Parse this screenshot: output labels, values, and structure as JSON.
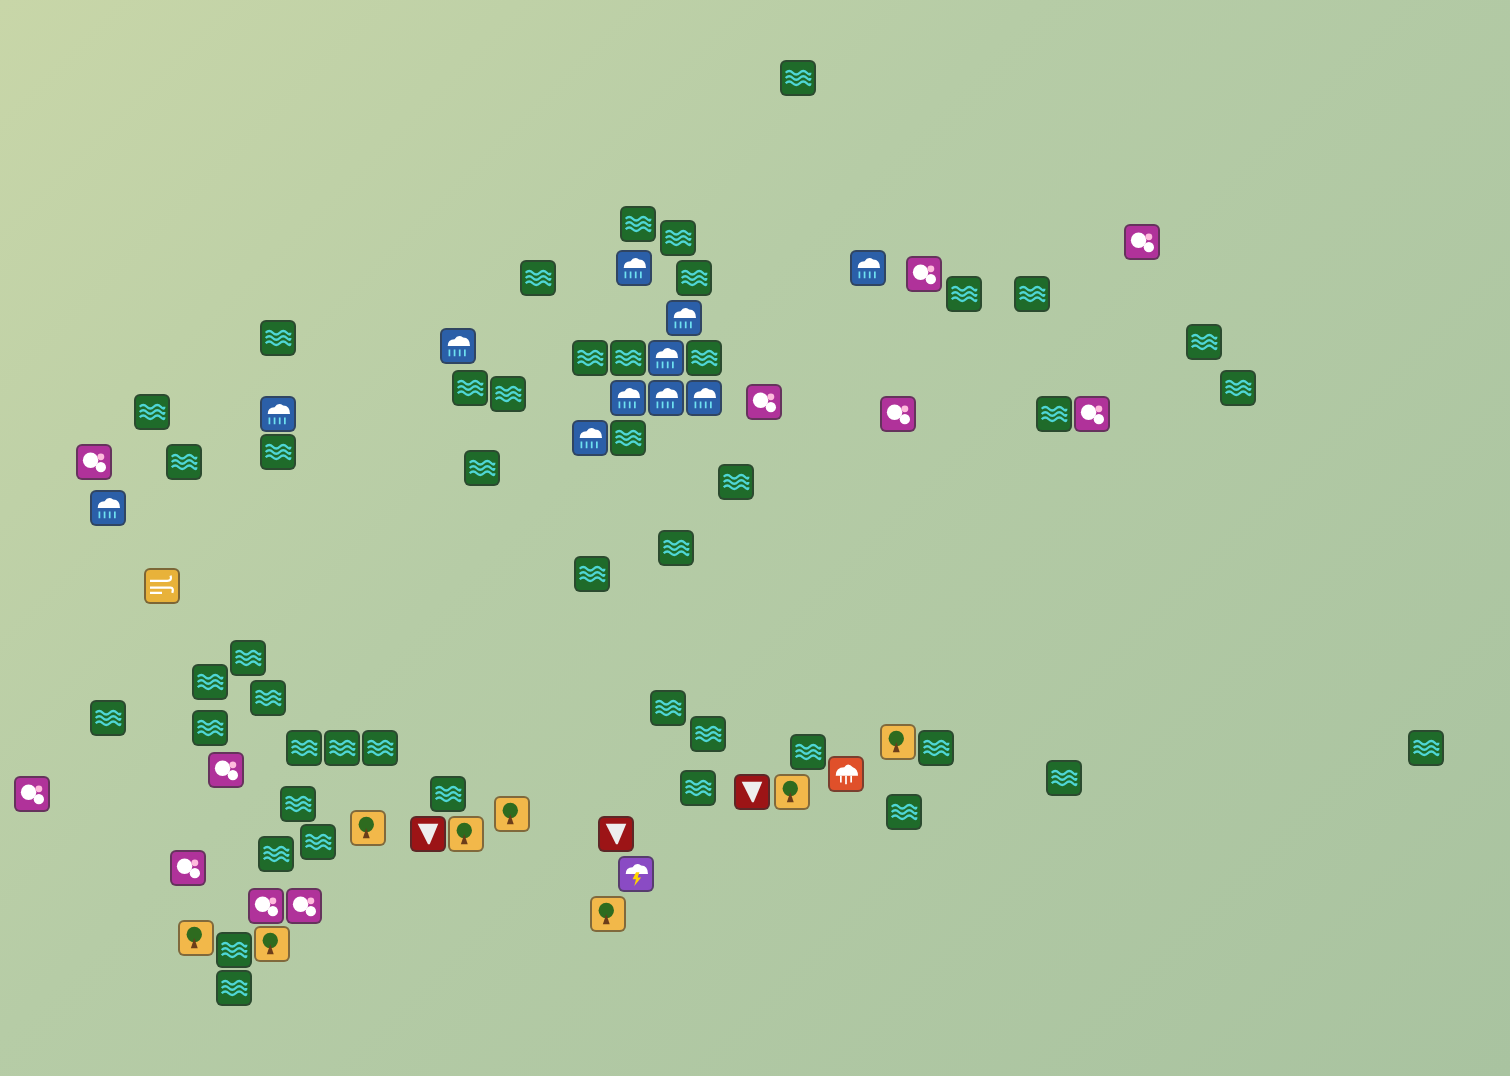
{
  "map": {
    "markers": [
      {
        "kind": "flood"
      },
      {
        "kind": "flood"
      },
      {
        "kind": "flood"
      },
      {
        "kind": "flood"
      },
      {
        "kind": "flood"
      },
      {
        "kind": "flood"
      },
      {
        "kind": "flood"
      },
      {
        "kind": "flood"
      },
      {
        "kind": "flood"
      },
      {
        "kind": "flood"
      },
      {
        "kind": "flood"
      },
      {
        "kind": "flood"
      },
      {
        "kind": "flood"
      },
      {
        "kind": "flood"
      },
      {
        "kind": "flood"
      },
      {
        "kind": "flood"
      },
      {
        "kind": "flood"
      },
      {
        "kind": "flood"
      },
      {
        "kind": "flood"
      },
      {
        "kind": "flood"
      },
      {
        "kind": "flood"
      },
      {
        "kind": "flood"
      },
      {
        "kind": "flood"
      },
      {
        "kind": "flood"
      },
      {
        "kind": "flood"
      },
      {
        "kind": "flood"
      },
      {
        "kind": "flood"
      },
      {
        "kind": "flood"
      },
      {
        "kind": "flood"
      },
      {
        "kind": "flood"
      },
      {
        "kind": "flood"
      },
      {
        "kind": "flood"
      },
      {
        "kind": "flood"
      },
      {
        "kind": "flood"
      },
      {
        "kind": "flood"
      },
      {
        "kind": "flood"
      },
      {
        "kind": "flood"
      },
      {
        "kind": "flood"
      },
      {
        "kind": "flood"
      },
      {
        "kind": "flood"
      },
      {
        "kind": "flood"
      },
      {
        "kind": "flood"
      },
      {
        "kind": "flood"
      },
      {
        "kind": "flood"
      },
      {
        "kind": "flood"
      },
      {
        "kind": "flood"
      },
      {
        "kind": "rain"
      },
      {
        "kind": "rain"
      },
      {
        "kind": "rain"
      },
      {
        "kind": "rain"
      },
      {
        "kind": "rain"
      },
      {
        "kind": "rain"
      },
      {
        "kind": "rain"
      },
      {
        "kind": "rain"
      },
      {
        "kind": "rain"
      },
      {
        "kind": "rain"
      },
      {
        "kind": "rain"
      },
      {
        "kind": "hail"
      },
      {
        "kind": "hail"
      },
      {
        "kind": "hail"
      },
      {
        "kind": "hail"
      },
      {
        "kind": "hail"
      },
      {
        "kind": "hail"
      },
      {
        "kind": "hail"
      },
      {
        "kind": "hail"
      },
      {
        "kind": "hail"
      },
      {
        "kind": "hail"
      },
      {
        "kind": "hail"
      },
      {
        "kind": "wind"
      },
      {
        "kind": "wind"
      },
      {
        "kind": "wind"
      },
      {
        "kind": "wind"
      },
      {
        "kind": "wind"
      },
      {
        "kind": "wind"
      },
      {
        "kind": "wind"
      },
      {
        "kind": "wind"
      },
      {
        "kind": "tornado"
      },
      {
        "kind": "tornado"
      },
      {
        "kind": "tornado"
      },
      {
        "kind": "lightning"
      },
      {
        "kind": "storm"
      },
      {
        "kind": "windsign"
      }
    ]
  }
}
